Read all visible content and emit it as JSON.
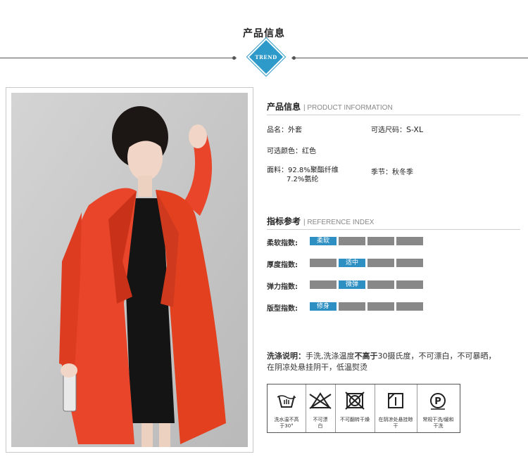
{
  "header": {
    "title": "产品信息",
    "badge": "TREND"
  },
  "product_info": {
    "title": "产品信息",
    "subtitle": "| PRODUCT INFORMATION",
    "name_label": "品名：",
    "name_value": "外套",
    "sizes_label": "可选尺码：",
    "sizes_value": "S-XL",
    "color_label": "可选颜色：",
    "color_value": "红色",
    "fabric_label": "面料：",
    "fabric_value_1": "92.8%聚酯纤维",
    "fabric_value_2": "7.2%氨纶",
    "season_label": "季节：",
    "season_value": "秋冬季"
  },
  "reference_index": {
    "title": "指标参考",
    "subtitle": "| REFERENCE INDEX",
    "rows": [
      {
        "label": "柔软指数:",
        "active": "柔软",
        "active_index": 0
      },
      {
        "label": "厚度指数:",
        "active": "适中",
        "active_index": 1
      },
      {
        "label": "弹力指数:",
        "active": "微弹",
        "active_index": 1
      },
      {
        "label": "版型指数:",
        "active": "修身",
        "active_index": 0
      }
    ]
  },
  "wash": {
    "label": "洗涤说明：",
    "text_1": "手洗,洗涤温度",
    "text_bold": "不高于",
    "text_2": "30摄氏度，不可漂白，不可暴晒，",
    "line_2": "在阴凉处悬挂阴干，低温熨烫"
  },
  "care_icons": [
    {
      "icon": "hand-wash-30-icon",
      "label_1": "洗水温不高",
      "label_2": "于30°"
    },
    {
      "icon": "no-bleach-icon",
      "label_1": "不可漂",
      "label_2": "白"
    },
    {
      "icon": "no-tumble-dry-icon",
      "label_1": "不可翻转干燥",
      "label_2": ""
    },
    {
      "icon": "line-dry-shade-icon",
      "label_1": "在阴凉处悬挂晾",
      "label_2": "干"
    },
    {
      "icon": "dry-clean-p-icon",
      "label_1": "常规干洗/缓和",
      "label_2": "干洗"
    }
  ],
  "colors": {
    "accent": "#2e8fc2",
    "bar": "#888888",
    "coat": "#e8452a"
  }
}
